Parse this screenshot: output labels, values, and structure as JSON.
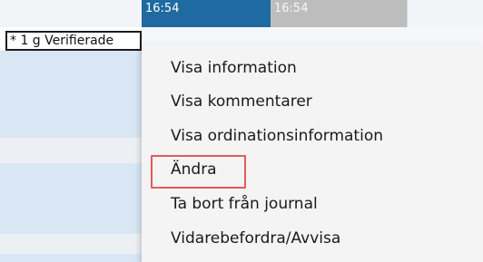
{
  "timeline": {
    "time_1": "16:54",
    "time_2": "16:54"
  },
  "grid": {
    "row_label": "* 1 g Verifierade"
  },
  "context_menu": {
    "items": [
      {
        "label": "Visa information"
      },
      {
        "label": "Visa kommentarer"
      },
      {
        "label": "Visa ordinationsinformation"
      },
      {
        "label": "Ändra",
        "highlighted": true
      },
      {
        "label": "Ta bort från journal"
      },
      {
        "label": "Vidarebefordra/Avvisa"
      }
    ]
  },
  "colors": {
    "time_block_primary": "#1f6aa0",
    "time_block_secondary": "#bdbdbd",
    "row_blue": "#d9e7f5",
    "row_grey": "#eceff3",
    "highlight_box": "#e25b5b",
    "menu_bg": "#f4f4f4"
  }
}
